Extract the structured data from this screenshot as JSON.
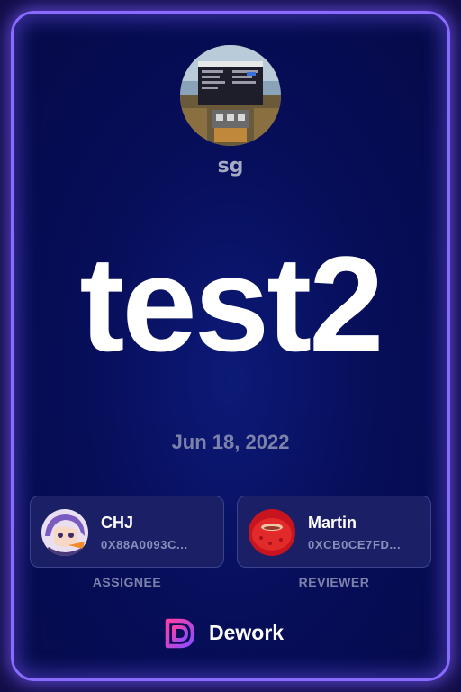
{
  "organization": {
    "name": "sg",
    "avatar_icon": "minecraft-scene-avatar"
  },
  "task": {
    "title": "test2",
    "date": "Jun 18, 2022"
  },
  "assignee": {
    "name": "CHJ",
    "address": "0X88A0093C...",
    "role_label": "ASSIGNEE",
    "avatar_icon": "anime-character-avatar"
  },
  "reviewer": {
    "name": "Martin",
    "address": "0XCB0CE7FD...",
    "role_label": "REVIEWER",
    "avatar_icon": "red-object-avatar"
  },
  "brand": {
    "name": "Dework",
    "logo_icon": "dework-logo-icon"
  },
  "colors": {
    "accent": "#8b6bff",
    "background": "#070e5a",
    "card": "#1b2066"
  }
}
